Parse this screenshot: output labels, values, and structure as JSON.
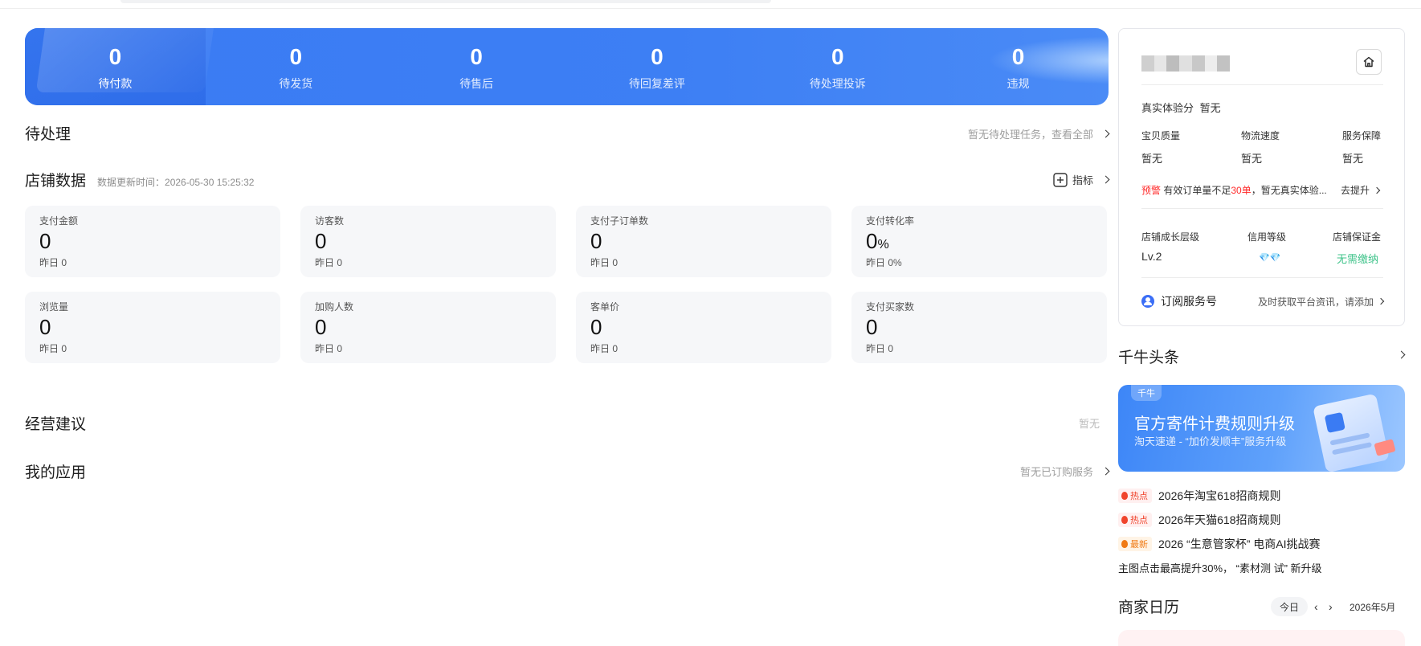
{
  "banner": {
    "stats": [
      {
        "value": "0",
        "label": "待付款"
      },
      {
        "value": "0",
        "label": "待发货"
      },
      {
        "value": "0",
        "label": "待售后"
      },
      {
        "value": "0",
        "label": "待回复差评"
      },
      {
        "value": "0",
        "label": "待处理投诉"
      },
      {
        "value": "0",
        "label": "违规"
      }
    ]
  },
  "pending": {
    "title": "待处理",
    "right_text": "暂无待处理任务，查看全部"
  },
  "shop_data": {
    "title": "店铺数据",
    "update_time": "数据更新时间：2026-05-30 15:25:32",
    "indicator_label": "指标",
    "cards": [
      {
        "label": "支付金额",
        "value": "0",
        "unit": "",
        "yesterday": "昨日 0"
      },
      {
        "label": "访客数",
        "value": "0",
        "unit": "",
        "yesterday": "昨日 0"
      },
      {
        "label": "支付子订单数",
        "value": "0",
        "unit": "",
        "yesterday": "昨日 0"
      },
      {
        "label": "支付转化率",
        "value": "0",
        "unit": "%",
        "yesterday": "昨日 0%"
      },
      {
        "label": "浏览量",
        "value": "0",
        "unit": "",
        "yesterday": "昨日 0"
      },
      {
        "label": "加购人数",
        "value": "0",
        "unit": "",
        "yesterday": "昨日 0"
      },
      {
        "label": "客单价",
        "value": "0",
        "unit": "",
        "yesterday": "昨日 0"
      },
      {
        "label": "支付买家数",
        "value": "0",
        "unit": "",
        "yesterday": "昨日 0"
      }
    ]
  },
  "advice": {
    "title": "经营建议",
    "right_text": "暂无"
  },
  "apps": {
    "title": "我的应用",
    "right_text": "暂无已订购服务"
  },
  "panel": {
    "experience_label": "真实体验分",
    "experience_value": "暂无",
    "scores": [
      {
        "label": "宝贝质量",
        "value": "暂无"
      },
      {
        "label": "物流速度",
        "value": "暂无"
      },
      {
        "label": "服务保障",
        "value": "暂无"
      }
    ],
    "warning_tag": "预警",
    "warning_pre": "有效订单量不足",
    "warning_num": "30单",
    "warning_post": "，暂无真实体验...",
    "warning_link": "去提升",
    "levels": [
      {
        "label": "店铺成长层级",
        "value": "Lv.2"
      },
      {
        "label": "信用等级",
        "value": "💎💎"
      },
      {
        "label": "店铺保证金",
        "value": "无需缴纳"
      }
    ],
    "subscribe_label": "订阅服务号",
    "subscribe_hint": "及时获取平台资讯，请添加"
  },
  "headlines": {
    "title": "千牛头条",
    "promo_tag": "千牛",
    "promo_title": "官方寄件计费规则升级",
    "promo_sub": "淘天速递 - “加价发顺丰”服务升级",
    "items": [
      {
        "badge": "热点",
        "type": "hot",
        "text": "2026年淘宝618招商规则"
      },
      {
        "badge": "热点",
        "type": "hot",
        "text": "2026年天猫618招商规则"
      },
      {
        "badge": "最新",
        "type": "new",
        "text": "2026 “生意管家杯” 电商AI挑战赛"
      },
      {
        "badge": "",
        "type": "",
        "text": "主图点击最高提升30%， “素材测 试” 新升级"
      }
    ]
  },
  "calendar": {
    "title": "商家日历",
    "today_label": "今日",
    "month": "2026年5月"
  },
  "colors": {
    "accent": "#3d7ff4",
    "warning": "#ff2a2a",
    "success": "#3fc38a"
  }
}
